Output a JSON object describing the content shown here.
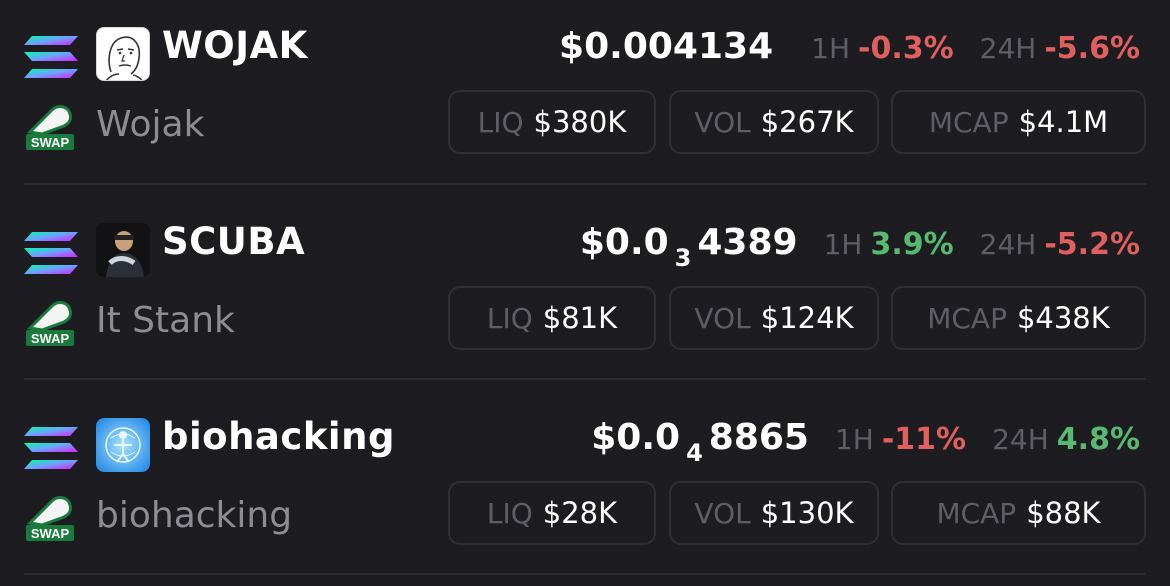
{
  "colors": {
    "background": "#1c1c21",
    "negative": "#e0605f",
    "positive": "#59b971",
    "muted": "#5e5e66"
  },
  "tokens": [
    {
      "chain_icon": "solana-icon",
      "avatar_icon": "wojak-meme-avatar",
      "symbol": "WOJAK",
      "swap_icon": "swap-icon",
      "swap_label": "SWAP",
      "name": "Wojak",
      "price_main": "$0.004134",
      "price_sub": "",
      "price_tail": "",
      "change_1h_label": "1H",
      "change_1h": "-0.3%",
      "change_24h_label": "24H",
      "change_24h": "-5.6%",
      "liq_label": "LIQ",
      "liq": "$380K",
      "vol_label": "VOL",
      "vol": "$267K",
      "mcap_label": "MCAP",
      "mcap": "$4.1M"
    },
    {
      "chain_icon": "solana-icon",
      "avatar_icon": "scuba-photo-avatar",
      "symbol": "SCUBA",
      "swap_icon": "swap-icon",
      "swap_label": "SWAP",
      "name": "It Stank",
      "price_main": "$0.0",
      "price_sub": "3",
      "price_tail": "4389",
      "change_1h_label": "1H",
      "change_1h": "3.9%",
      "change_24h_label": "24H",
      "change_24h": "-5.2%",
      "liq_label": "LIQ",
      "liq": "$81K",
      "vol_label": "VOL",
      "vol": "$124K",
      "mcap_label": "MCAP",
      "mcap": "$438K"
    },
    {
      "chain_icon": "solana-icon",
      "avatar_icon": "biohacking-avatar",
      "symbol": "biohacking",
      "swap_icon": "swap-icon",
      "swap_label": "SWAP",
      "name": "biohacking",
      "price_main": "$0.0",
      "price_sub": "4",
      "price_tail": "8865",
      "change_1h_label": "1H",
      "change_1h": "-11%",
      "change_24h_label": "24H",
      "change_24h": "4.8%",
      "liq_label": "LIQ",
      "liq": "$28K",
      "vol_label": "VOL",
      "vol": "$130K",
      "mcap_label": "MCAP",
      "mcap": "$88K"
    }
  ]
}
